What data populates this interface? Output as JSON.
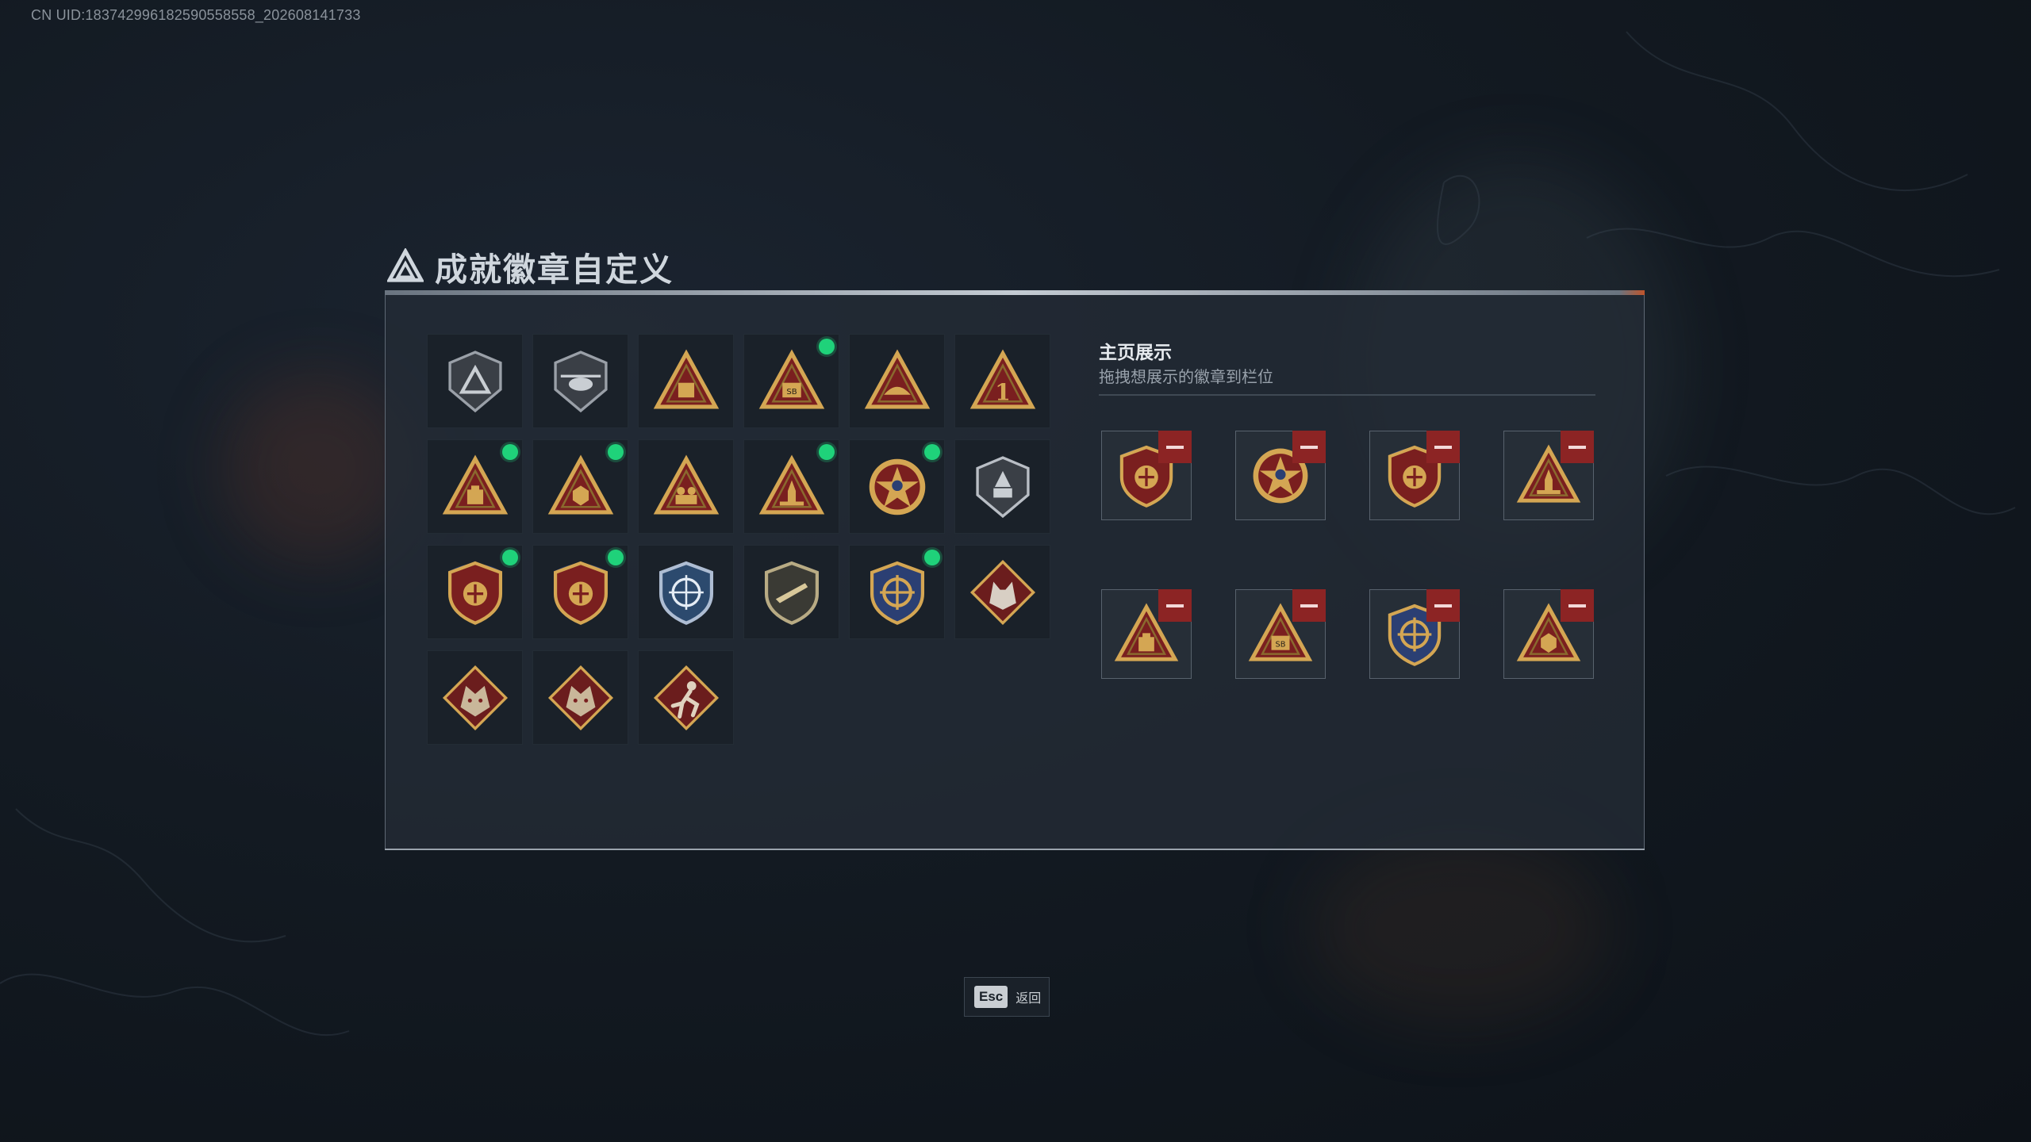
{
  "uid_text": "CN UID:1837429961825905585​58_202608141733",
  "panel": {
    "title": "成就徽章自定义",
    "title_tag": "■■■■■■ · ■■■■ · ■■■■"
  },
  "display": {
    "title": "主页展示",
    "subtitle": "拖拽想展示的徽章到栏位"
  },
  "esc": {
    "key": "Esc",
    "label": "返回"
  },
  "colors": {
    "accent_new": "#1fd27a",
    "remove_red": "#8c2424",
    "gold": "#d4a653",
    "maroon": "#7a1f1f"
  },
  "badges": [
    {
      "icon": "shield-triangle-badge-icon",
      "new": false
    },
    {
      "icon": "helicopter-shield-badge-icon",
      "new": false
    },
    {
      "icon": "map-triangle-badge-icon",
      "new": false
    },
    {
      "icon": "sb-triangle-badge-icon",
      "new": true
    },
    {
      "icon": "hands-triangle-badge-icon",
      "new": false
    },
    {
      "icon": "number-one-triangle-badge-icon",
      "new": false
    },
    {
      "icon": "crate-triangle-badge-icon",
      "new": true
    },
    {
      "icon": "hex-triangle-badge-icon",
      "new": true
    },
    {
      "icon": "soldiers-triangle-badge-icon",
      "new": false
    },
    {
      "icon": "rocket-triangle-badge-icon",
      "new": true
    },
    {
      "icon": "star-skull-badge-icon",
      "new": true
    },
    {
      "icon": "hand-shield-badge-icon",
      "new": false
    },
    {
      "icon": "eagle-shield-badge-icon",
      "new": true
    },
    {
      "icon": "eagle-shield-badge-icon",
      "new": true
    },
    {
      "icon": "crosshair-shield-blue-badge-icon",
      "new": false
    },
    {
      "icon": "rifle-shield-badge-icon",
      "new": false
    },
    {
      "icon": "crosshair-shield-gold-badge-icon",
      "new": true
    },
    {
      "icon": "wolf-diamond-badge-icon",
      "new": false
    },
    {
      "icon": "dragon-diamond-badge-icon",
      "new": false
    },
    {
      "icon": "dragon-diamond-badge-icon",
      "new": false
    },
    {
      "icon": "runner-diamond-badge-icon",
      "new": false
    }
  ],
  "slots": [
    {
      "icon": "eagle-shield-badge-icon"
    },
    {
      "icon": "star-skull-badge-icon"
    },
    {
      "icon": "eagle-shield-badge-icon"
    },
    {
      "icon": "rocket-triangle-badge-icon"
    },
    {
      "icon": "crate-triangle-badge-icon"
    },
    {
      "icon": "sb-triangle-badge-icon"
    },
    {
      "icon": "crosshair-shield-gold-badge-icon"
    },
    {
      "icon": "hex-triangle-badge-icon"
    }
  ]
}
